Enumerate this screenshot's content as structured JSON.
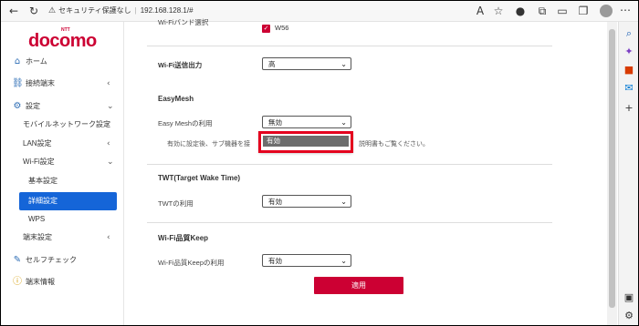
{
  "browser": {
    "security_label": "セキュリティ保護なし",
    "url": "192.168.128.1/#"
  },
  "nav": {
    "logo": "docomo",
    "logo_mark": "NTT",
    "items": [
      {
        "label": "ホーム"
      },
      {
        "label": "接続端末"
      },
      {
        "label": "設定"
      },
      {
        "label": "モバイルネットワーク設定"
      },
      {
        "label": "LAN設定"
      },
      {
        "label": "Wi-Fi設定"
      },
      {
        "label": "基本設定"
      },
      {
        "label": "詳細設定"
      },
      {
        "label": "WPS"
      },
      {
        "label": "端末設定"
      },
      {
        "label": "セルフチェック"
      },
      {
        "label": "端末情報"
      }
    ]
  },
  "main": {
    "band_label": "Wi-Fiバンド選択",
    "band_option": "W56",
    "tx_power_label": "Wi-Fi送信出力",
    "tx_power_value": "高",
    "easymesh_title": "EasyMesh",
    "easymesh_use_label": "Easy Meshの利用",
    "easymesh_use_value": "無効",
    "easymesh_note_left": "有効に設定後、サブ機器を接",
    "easymesh_note_right": "説明書もご覧ください。",
    "dropdown_option": "有効",
    "twt_title": "TWT(Target Wake Time)",
    "twt_use_label": "TWTの利用",
    "twt_use_value": "有効",
    "keep_title": "Wi-Fi品質Keep",
    "keep_use_label": "Wi-Fi品質Keepの利用",
    "keep_use_value": "有効",
    "apply_label": "適用"
  }
}
